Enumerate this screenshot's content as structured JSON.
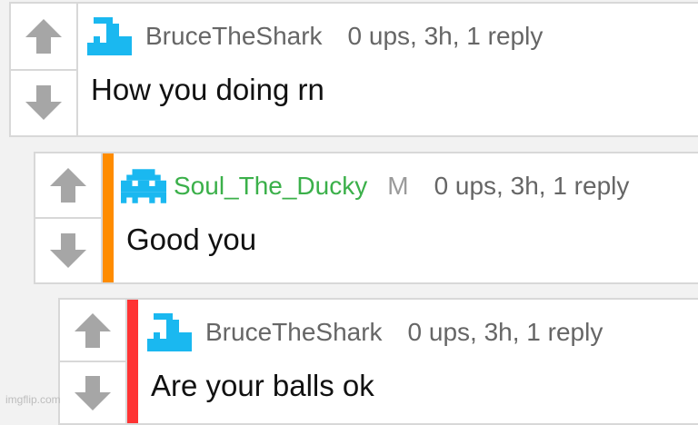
{
  "comments": [
    {
      "username": "BruceTheShark",
      "mod_badge": "",
      "meta": "0 ups, 3h, 1 reply",
      "text": "How you doing rn",
      "username_color": "#666666",
      "bar_color": "",
      "avatar_icon": "shark-avatar-icon"
    },
    {
      "username": "Soul_The_Ducky",
      "mod_badge": "M",
      "meta": "0 ups, 3h, 1 reply",
      "text": "Good you",
      "username_color": "#3bb04a",
      "bar_color": "#ff8c00",
      "avatar_icon": "pixel-ghost-avatar-icon"
    },
    {
      "username": "BruceTheShark",
      "mod_badge": "",
      "meta": "0 ups, 3h, 1 reply",
      "text": "Are your balls ok",
      "username_color": "#666666",
      "bar_color": "#ff3333",
      "avatar_icon": "shark-avatar-icon"
    }
  ],
  "colors": {
    "avatar": "#1ab8f0",
    "vote_arrow": "#a6a6a6"
  },
  "watermark": "imgflip.com"
}
